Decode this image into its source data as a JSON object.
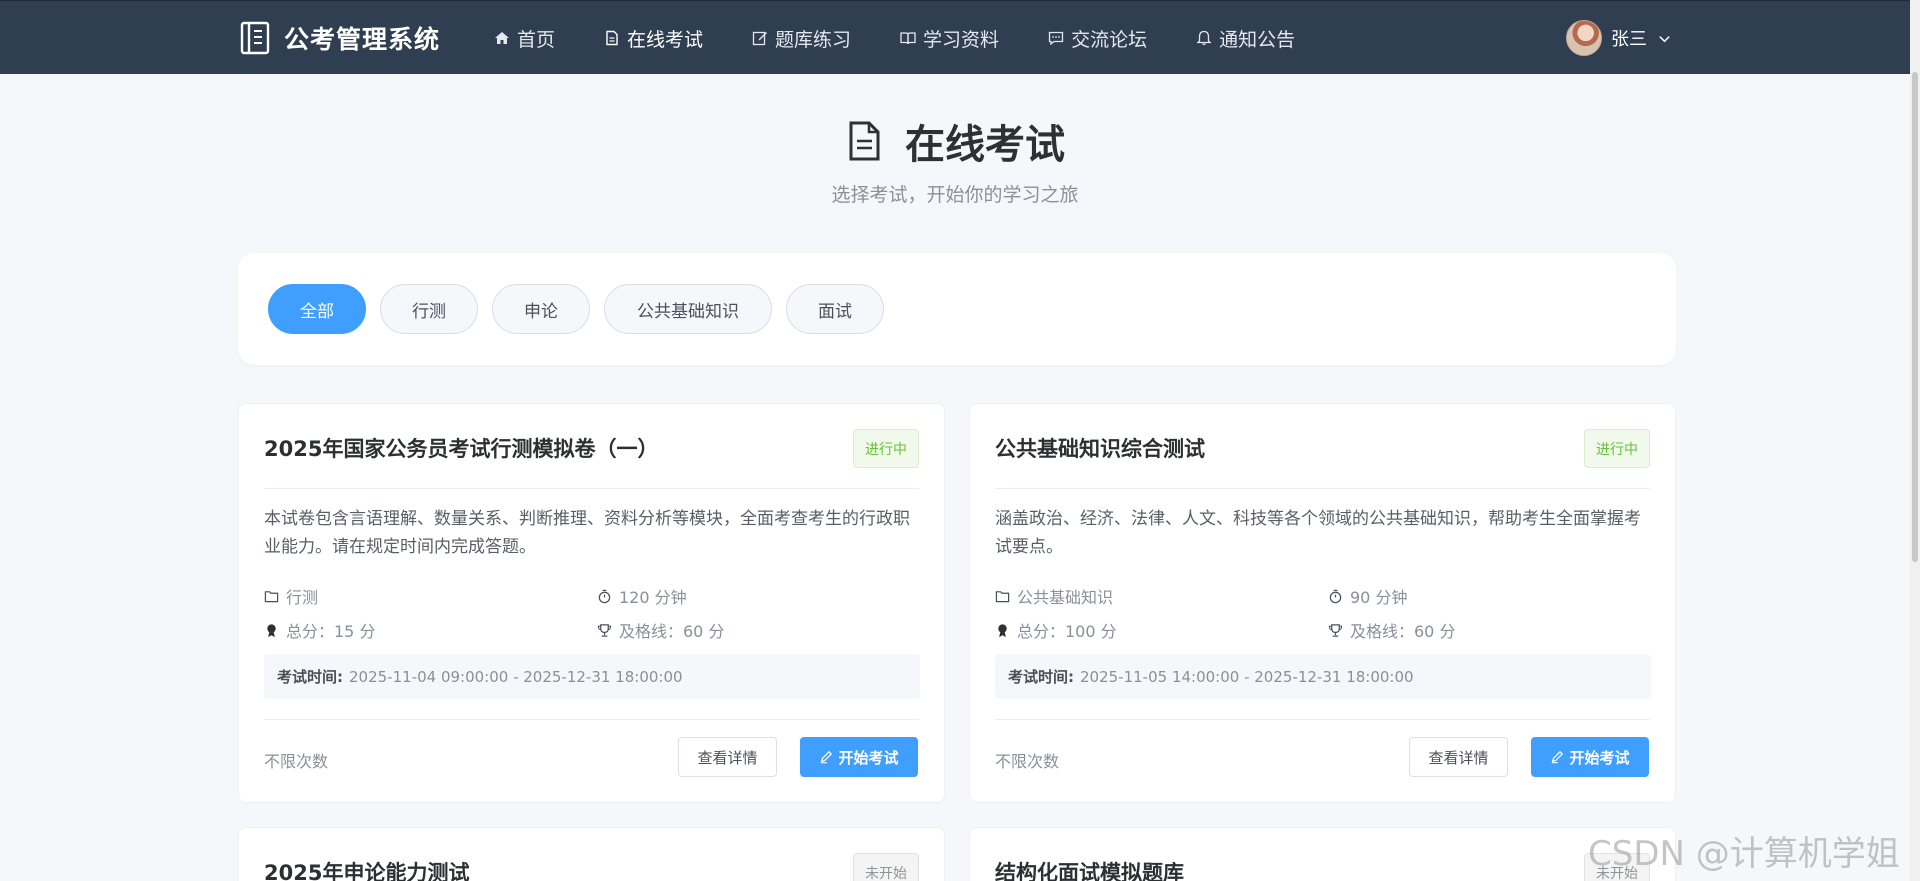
{
  "brand": {
    "title": "公考管理系统",
    "icon": "book-icon"
  },
  "nav": [
    {
      "label": "首页",
      "icon": "home-icon"
    },
    {
      "label": "在线考试",
      "icon": "document-icon",
      "active": true
    },
    {
      "label": "题库练习",
      "icon": "edit-icon"
    },
    {
      "label": "学习资料",
      "icon": "book-open-icon"
    },
    {
      "label": "交流论坛",
      "icon": "chat-icon"
    },
    {
      "label": "通知公告",
      "icon": "bell-icon"
    }
  ],
  "user": {
    "name": "张三"
  },
  "page": {
    "title": "在线考试",
    "subtitle": "选择考试，开始你的学习之旅"
  },
  "filters": [
    "全部",
    "行测",
    "申论",
    "公共基础知识",
    "面试"
  ],
  "exams": [
    {
      "title": "2025年国家公务员考试行测模拟卷（一）",
      "status": "进行中",
      "description": "本试卷包含言语理解、数量关系、判断推理、资料分析等模块，全面考查考生的行政职业能力。请在规定时间内完成答题。",
      "category": "行测",
      "duration": "120 分钟",
      "total": "总分：15 分",
      "pass": "及格线：60 分",
      "time_label": "考试时间:",
      "time": "2025-11-04 09:00:00 - 2025-12-31 18:00:00",
      "attempts": "不限次数",
      "detail_label": "查看详情",
      "start_label": "开始考试"
    },
    {
      "title": "公共基础知识综合测试",
      "status": "进行中",
      "description": "涵盖政治、经济、法律、人文、科技等各个领域的公共基础知识，帮助考生全面掌握考试要点。",
      "category": "公共基础知识",
      "duration": "90 分钟",
      "total": "总分：100 分",
      "pass": "及格线：60 分",
      "time_label": "考试时间:",
      "time": "2025-11-05 14:00:00 - 2025-12-31 18:00:00",
      "attempts": "不限次数",
      "detail_label": "查看详情",
      "start_label": "开始考试"
    },
    {
      "title": "2025年申论能力测试",
      "status": "未开始"
    },
    {
      "title": "结构化面试模拟题库",
      "status": "未开始"
    }
  ],
  "colors": {
    "navbar": "#2f3e50",
    "primary": "#409eff",
    "success": "#67c23a"
  },
  "watermark": "CSDN @计算机学姐"
}
